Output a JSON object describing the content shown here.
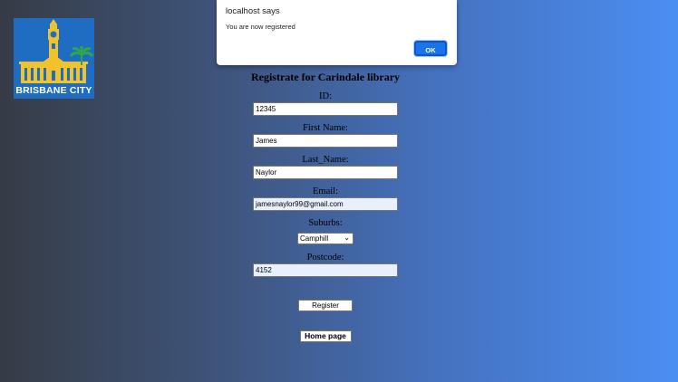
{
  "dialog": {
    "title": "localhost says",
    "message": "You are now registered",
    "ok_label": "OK"
  },
  "logo": {
    "text": "BRISBANE CITY"
  },
  "form": {
    "title": "Registrate for Carindale library",
    "fields": [
      {
        "label": "ID:",
        "value": "12345"
      },
      {
        "label": "First Name:",
        "value": "James"
      },
      {
        "label": "Last_Name:",
        "value": "Naylor"
      },
      {
        "label": "Email:",
        "value": "jamesnaylor99@gmail.com"
      },
      {
        "label": "Suburbs:",
        "value": "Camphill"
      },
      {
        "label": "Postcode:",
        "value": "4152"
      }
    ],
    "register_label": "Register",
    "home_label": "Home page"
  },
  "colors": {
    "background_left": "#363c46",
    "background_right": "#4b8ef2",
    "logo_blue": "#1e6dc2",
    "dialog_button": "#1a73e8"
  }
}
